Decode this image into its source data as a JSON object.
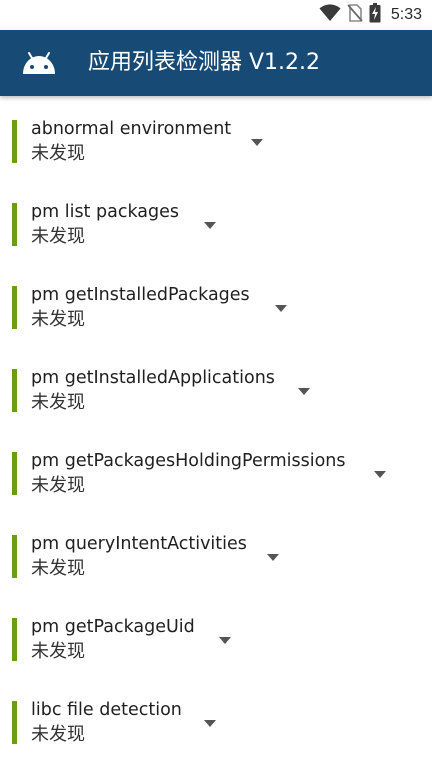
{
  "status_bar": {
    "time": "5:33",
    "icons": [
      "wifi-icon",
      "no-sim-icon",
      "battery-charging-icon"
    ]
  },
  "app_bar": {
    "icon": "android-icon",
    "title": "应用列表检测器 V1.2.2",
    "background_color": "#174a75"
  },
  "accent_color": "#6a9e10",
  "items": [
    {
      "title": "abnormal environment",
      "status": "未发现"
    },
    {
      "title": "pm list packages",
      "status": "未发现"
    },
    {
      "title": "pm getInstalledPackages",
      "status": "未发现"
    },
    {
      "title": "pm getInstalledApplications",
      "status": "未发现"
    },
    {
      "title": "pm getPackagesHoldingPermissions",
      "status": "未发现"
    },
    {
      "title": "pm queryIntentActivities",
      "status": "未发现"
    },
    {
      "title": "pm getPackageUid",
      "status": "未发现"
    },
    {
      "title": "libc file detection",
      "status": "未发现"
    }
  ]
}
